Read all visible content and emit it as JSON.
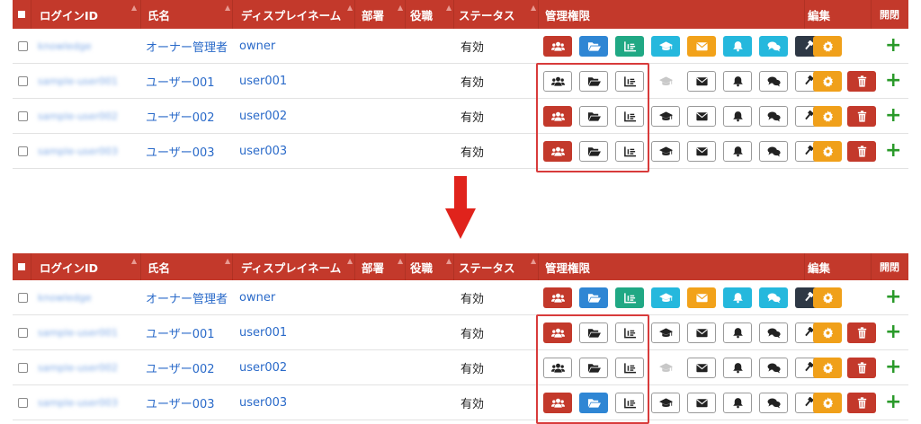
{
  "headers": {
    "login_id": "ログインID",
    "name": "氏名",
    "display_name": "ディスプレイネーム",
    "department": "部署",
    "position": "役職",
    "status": "ステータス",
    "permissions": "管理権限",
    "edit": "編集",
    "open_close": "開閉"
  },
  "icons": {
    "perm_order": [
      "users-icon",
      "folder-open-icon",
      "chart-icon",
      "graduation-cap-icon",
      "envelope-icon",
      "bell-icon",
      "comments-icon",
      "gavel-icon"
    ],
    "edit_gear": "gear-icon",
    "delete": "trash-icon",
    "expand": "plus-icon"
  },
  "colors": {
    "header_bg": "#c3392b",
    "perm_on": [
      "#c3392b",
      "#2f86d4",
      "#20a884",
      "#25b8dd",
      "#f2a21a",
      "#25b8dd",
      "#25b8dd",
      "#2e3845"
    ],
    "edit_gear_bg": "#f0a01a",
    "delete_bg": "#c3392b",
    "plus": "#2a9a2a",
    "highlight": "#d83b3b",
    "arrow": "#e0231c"
  },
  "tables": [
    {
      "rows": [
        {
          "login_id": "knowledge",
          "name": "オーナー管理者",
          "display_name": "owner",
          "status": "有効",
          "perms": [
            "on",
            "on",
            "on",
            "on",
            "on",
            "on",
            "on",
            "on"
          ],
          "deletable": false
        },
        {
          "login_id": "sample-user001",
          "name": "ユーザー001",
          "display_name": "user001",
          "status": "有効",
          "perms": [
            "off",
            "off",
            "off",
            "disabled",
            "off",
            "off",
            "off",
            "off"
          ],
          "deletable": true
        },
        {
          "login_id": "sample-user002",
          "name": "ユーザー002",
          "display_name": "user002",
          "status": "有効",
          "perms": [
            "on",
            "off",
            "off",
            "off",
            "off",
            "off",
            "off",
            "off"
          ],
          "deletable": true
        },
        {
          "login_id": "sample-user003",
          "name": "ユーザー003",
          "display_name": "user003",
          "status": "有効",
          "perms": [
            "on",
            "off",
            "off",
            "off",
            "off",
            "off",
            "off",
            "off"
          ],
          "deletable": true
        }
      ]
    },
    {
      "rows": [
        {
          "login_id": "knowledge",
          "name": "オーナー管理者",
          "display_name": "owner",
          "status": "有効",
          "perms": [
            "on",
            "on",
            "on",
            "on",
            "on",
            "on",
            "on",
            "on"
          ],
          "deletable": false
        },
        {
          "login_id": "sample-user001",
          "name": "ユーザー001",
          "display_name": "user001",
          "status": "有効",
          "perms": [
            "on",
            "off",
            "off",
            "off",
            "off",
            "off",
            "off",
            "off"
          ],
          "deletable": true
        },
        {
          "login_id": "sample-user002",
          "name": "ユーザー002",
          "display_name": "user002",
          "status": "有効",
          "perms": [
            "off",
            "off",
            "off",
            "disabled",
            "off",
            "off",
            "off",
            "off"
          ],
          "deletable": true
        },
        {
          "login_id": "sample-user003",
          "name": "ユーザー003",
          "display_name": "user003",
          "status": "有効",
          "perms": [
            "on",
            "on",
            "off",
            "off",
            "off",
            "off",
            "off",
            "off"
          ],
          "deletable": true
        }
      ]
    }
  ]
}
